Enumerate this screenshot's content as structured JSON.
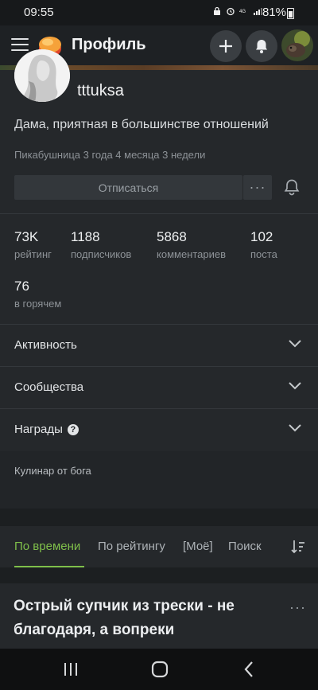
{
  "status_bar": {
    "time": "09:55",
    "battery": "81%"
  },
  "header": {
    "title": "Профиль"
  },
  "profile": {
    "username": "tttuksa",
    "bio": "Дама, приятная в большинстве отношений",
    "member_since": "Пикабушница 3 года 4 месяца 3 недели",
    "unsubscribe_label": "Отписаться",
    "more_label": "···"
  },
  "stats": [
    {
      "value": "73K",
      "label": "рейтинг"
    },
    {
      "value": "1188",
      "label": "подписчиков"
    },
    {
      "value": "5868",
      "label": "комментариев"
    },
    {
      "value": "102",
      "label": "поста"
    },
    {
      "value": "76",
      "label": "в горячем"
    }
  ],
  "sections": [
    {
      "label": "Активность"
    },
    {
      "label": "Сообщества"
    },
    {
      "label": "Награды"
    }
  ],
  "info": {
    "text": "Кулинар от бога"
  },
  "tabs": [
    {
      "label": "По времени",
      "active": true
    },
    {
      "label": "По рейтингу",
      "active": false
    },
    {
      "label": "[Моё]",
      "active": false
    },
    {
      "label": "Поиск",
      "active": false
    }
  ],
  "post": {
    "title": "Острый супчик из трески - не благодаря, а вопреки",
    "more_label": "···"
  },
  "colors": {
    "accent": "#7fbf4a",
    "background": "#25282b",
    "header": "#1e2124"
  }
}
